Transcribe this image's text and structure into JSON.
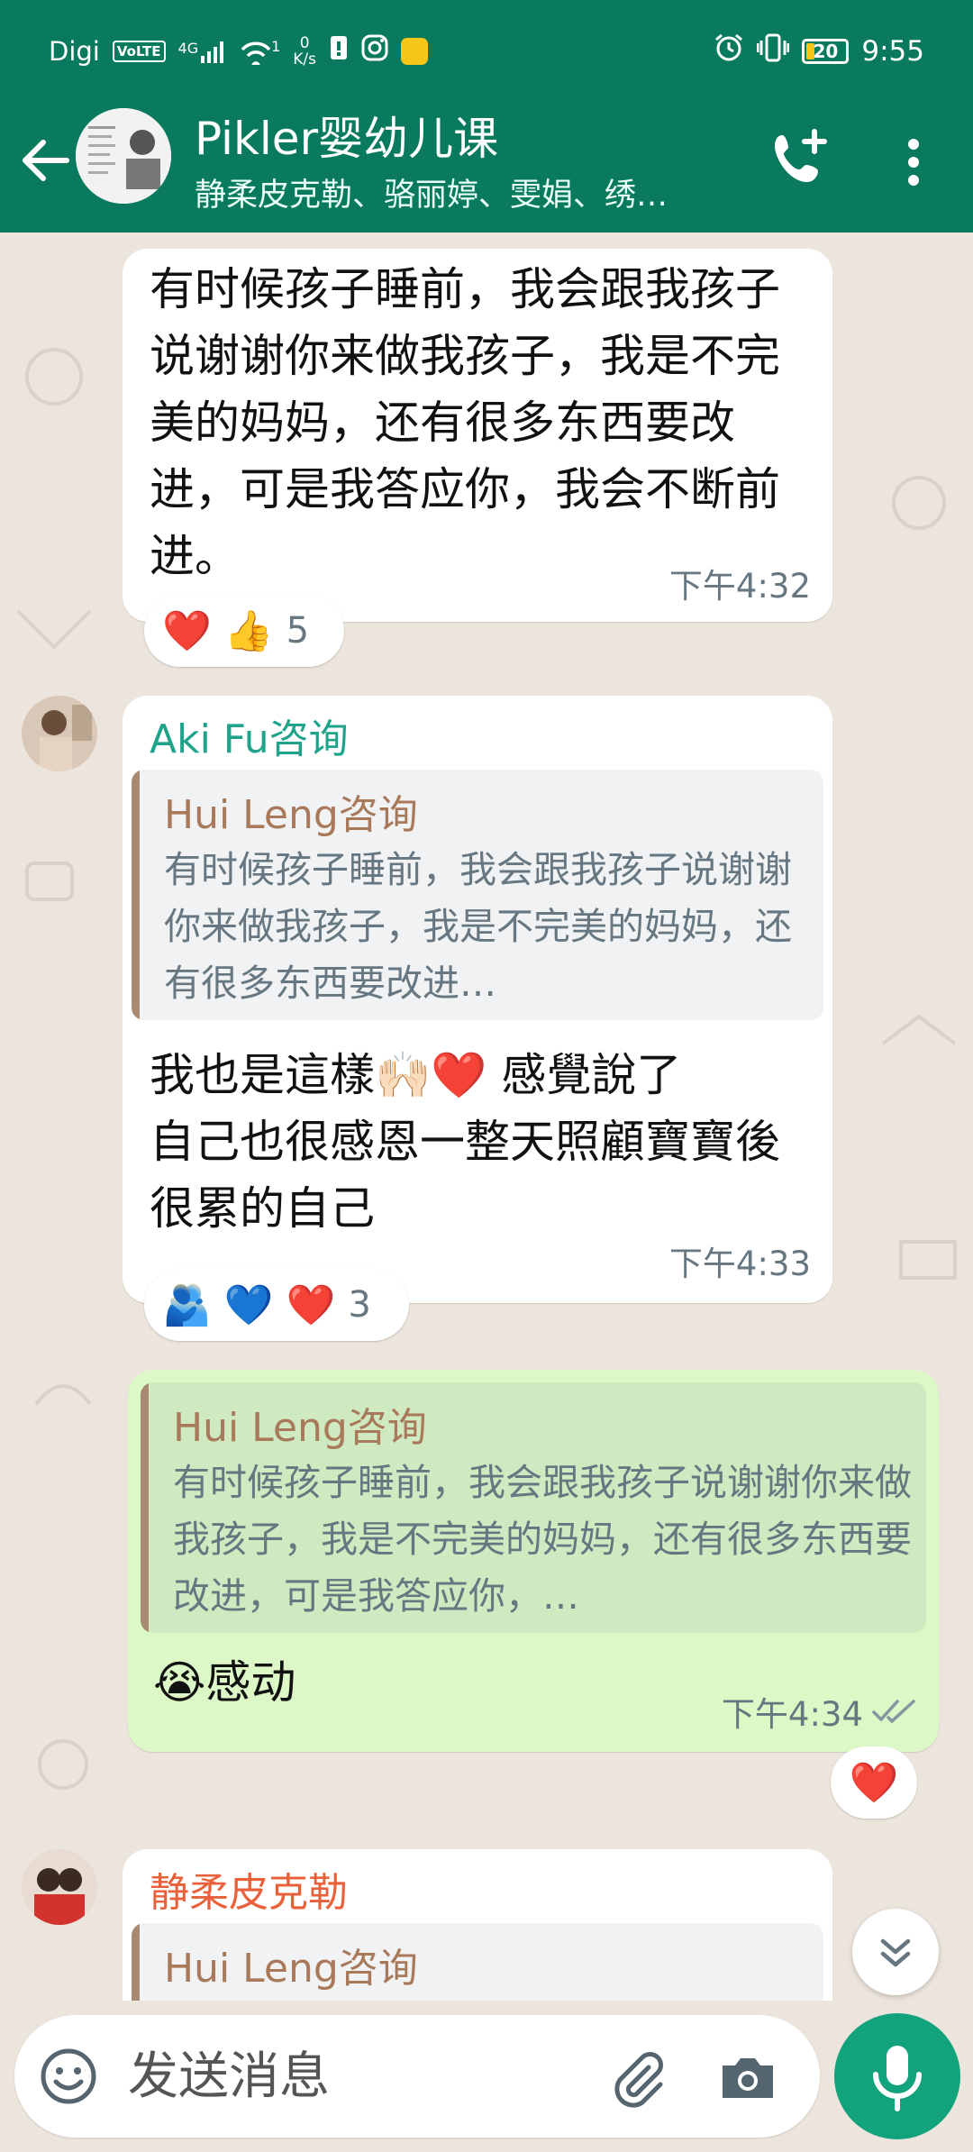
{
  "status_bar": {
    "carrier": "Digi",
    "volte": "VoLTE",
    "network": "4G",
    "hotspot_count": "1",
    "speed_value": "0",
    "speed_unit": "K/s",
    "battery": "20",
    "time": "9:55"
  },
  "header": {
    "title": "Pikler婴幼儿课",
    "members": "静柔皮克勒、骆丽婷、雯娟、绣…",
    "accent": "#0a7a5f"
  },
  "messages": [
    {
      "text": "有时候孩子睡前，我会跟我孩子说谢谢你来做我孩子，我是不完美的妈妈，还有很多东西要改进，可是我答应你，我会不断前进。",
      "time": "下午4:32",
      "reactions": {
        "emojis": "❤️ 👍",
        "count": "5"
      }
    },
    {
      "sender": "Aki Fu咨询",
      "sender_color": "#1fa48b",
      "quote_name": "Hui Leng咨询",
      "quote_text": "有时候孩子睡前，我会跟我孩子说谢谢你来做我孩子，我是不完美的妈妈，还有很多东西要改进…",
      "text_line1": "我也是這樣🙌🏻❤️ 感覺說了",
      "text_line2": "自己也很感恩一整天照顧寶寶後很累的自己",
      "time": "下午4:33",
      "reactions": {
        "emojis": "🫂 💙 ❤️",
        "count": "3"
      }
    },
    {
      "outgoing": true,
      "quote_name": "Hui Leng咨询",
      "quote_text": "有时候孩子睡前，我会跟我孩子说谢谢你来做我孩子，我是不完美的妈妈，还有很多东西要改进，可是我答应你，…",
      "text": "😭感动",
      "time": "下午4:34",
      "reactions": {
        "emojis": "❤️"
      }
    },
    {
      "sender": "静柔皮克勒",
      "sender_color": "#e8613a",
      "quote_name": "Hui Leng咨询"
    }
  ],
  "composer": {
    "placeholder": "发送消息"
  }
}
